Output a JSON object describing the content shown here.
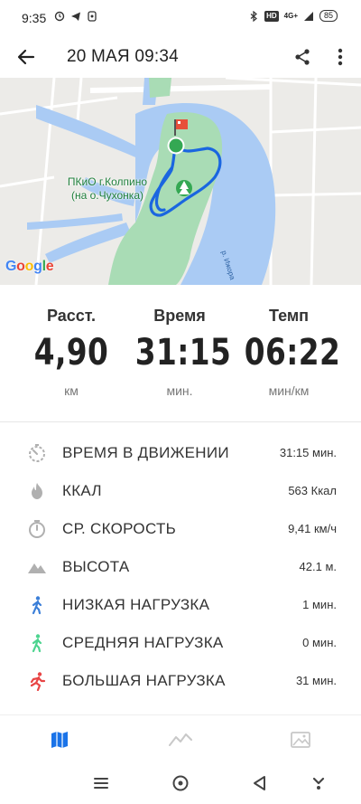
{
  "status_bar": {
    "time": "9:35",
    "network": "4G+",
    "hd_badge": "HD",
    "battery": "85"
  },
  "header": {
    "title": "20 МАЯ 09:34"
  },
  "map": {
    "park_label_line1": "ПКиО г.Колпино",
    "park_label_line2": "(на о.Чухонка)",
    "river_label": "р. Ижора",
    "attribution": "Google"
  },
  "summary": {
    "distance": {
      "label": "Расст.",
      "value": "4,90",
      "unit": "км"
    },
    "time": {
      "label": "Время",
      "value": "31:15",
      "unit": "мин."
    },
    "pace": {
      "label": "Темп",
      "value": "06:22",
      "unit": "мин/км"
    }
  },
  "details": [
    {
      "label": "ВРЕМЯ В ДВИЖЕНИИ",
      "value": "31:15 мин.",
      "icon": "stopwatch-dashed-icon",
      "color": "#b0b0b0"
    },
    {
      "label": "ККАЛ",
      "value": "563 Ккал",
      "icon": "flame-icon",
      "color": "#b0b0b0"
    },
    {
      "label": "СР. СКОРОСТЬ",
      "value": "9,41 км/ч",
      "icon": "stopwatch-icon",
      "color": "#b0b0b0"
    },
    {
      "label": "ВЫСОТА",
      "value": "42.1 м.",
      "icon": "mountain-icon",
      "color": "#b0b0b0"
    },
    {
      "label": "НИЗКАЯ НАГРУЗКА",
      "value": "1 мин.",
      "icon": "walking-person-icon",
      "color": "#3b7fd8"
    },
    {
      "label": "СРЕДНЯЯ НАГРУЗКА",
      "value": "0 мин.",
      "icon": "walking-person-icon",
      "color": "#4dd48f"
    },
    {
      "label": "БОЛЬШАЯ НАГРУЗКА",
      "value": "31 мин.",
      "icon": "running-person-icon",
      "color": "#e84545"
    }
  ],
  "tabs": [
    {
      "name": "map-tab",
      "icon": "map-icon",
      "active": true,
      "color": "#1a73e8"
    },
    {
      "name": "chart-tab",
      "icon": "line-chart-icon",
      "active": false,
      "color": "#c8c8c8"
    },
    {
      "name": "photo-tab",
      "icon": "image-icon",
      "active": false,
      "color": "#c8c8c8"
    }
  ],
  "colors": {
    "route": "#1a66e0",
    "water": "#aacbf4",
    "park": "#a9dcb5",
    "start_marker": "#34a853",
    "finish_flag": "#e8503a"
  }
}
